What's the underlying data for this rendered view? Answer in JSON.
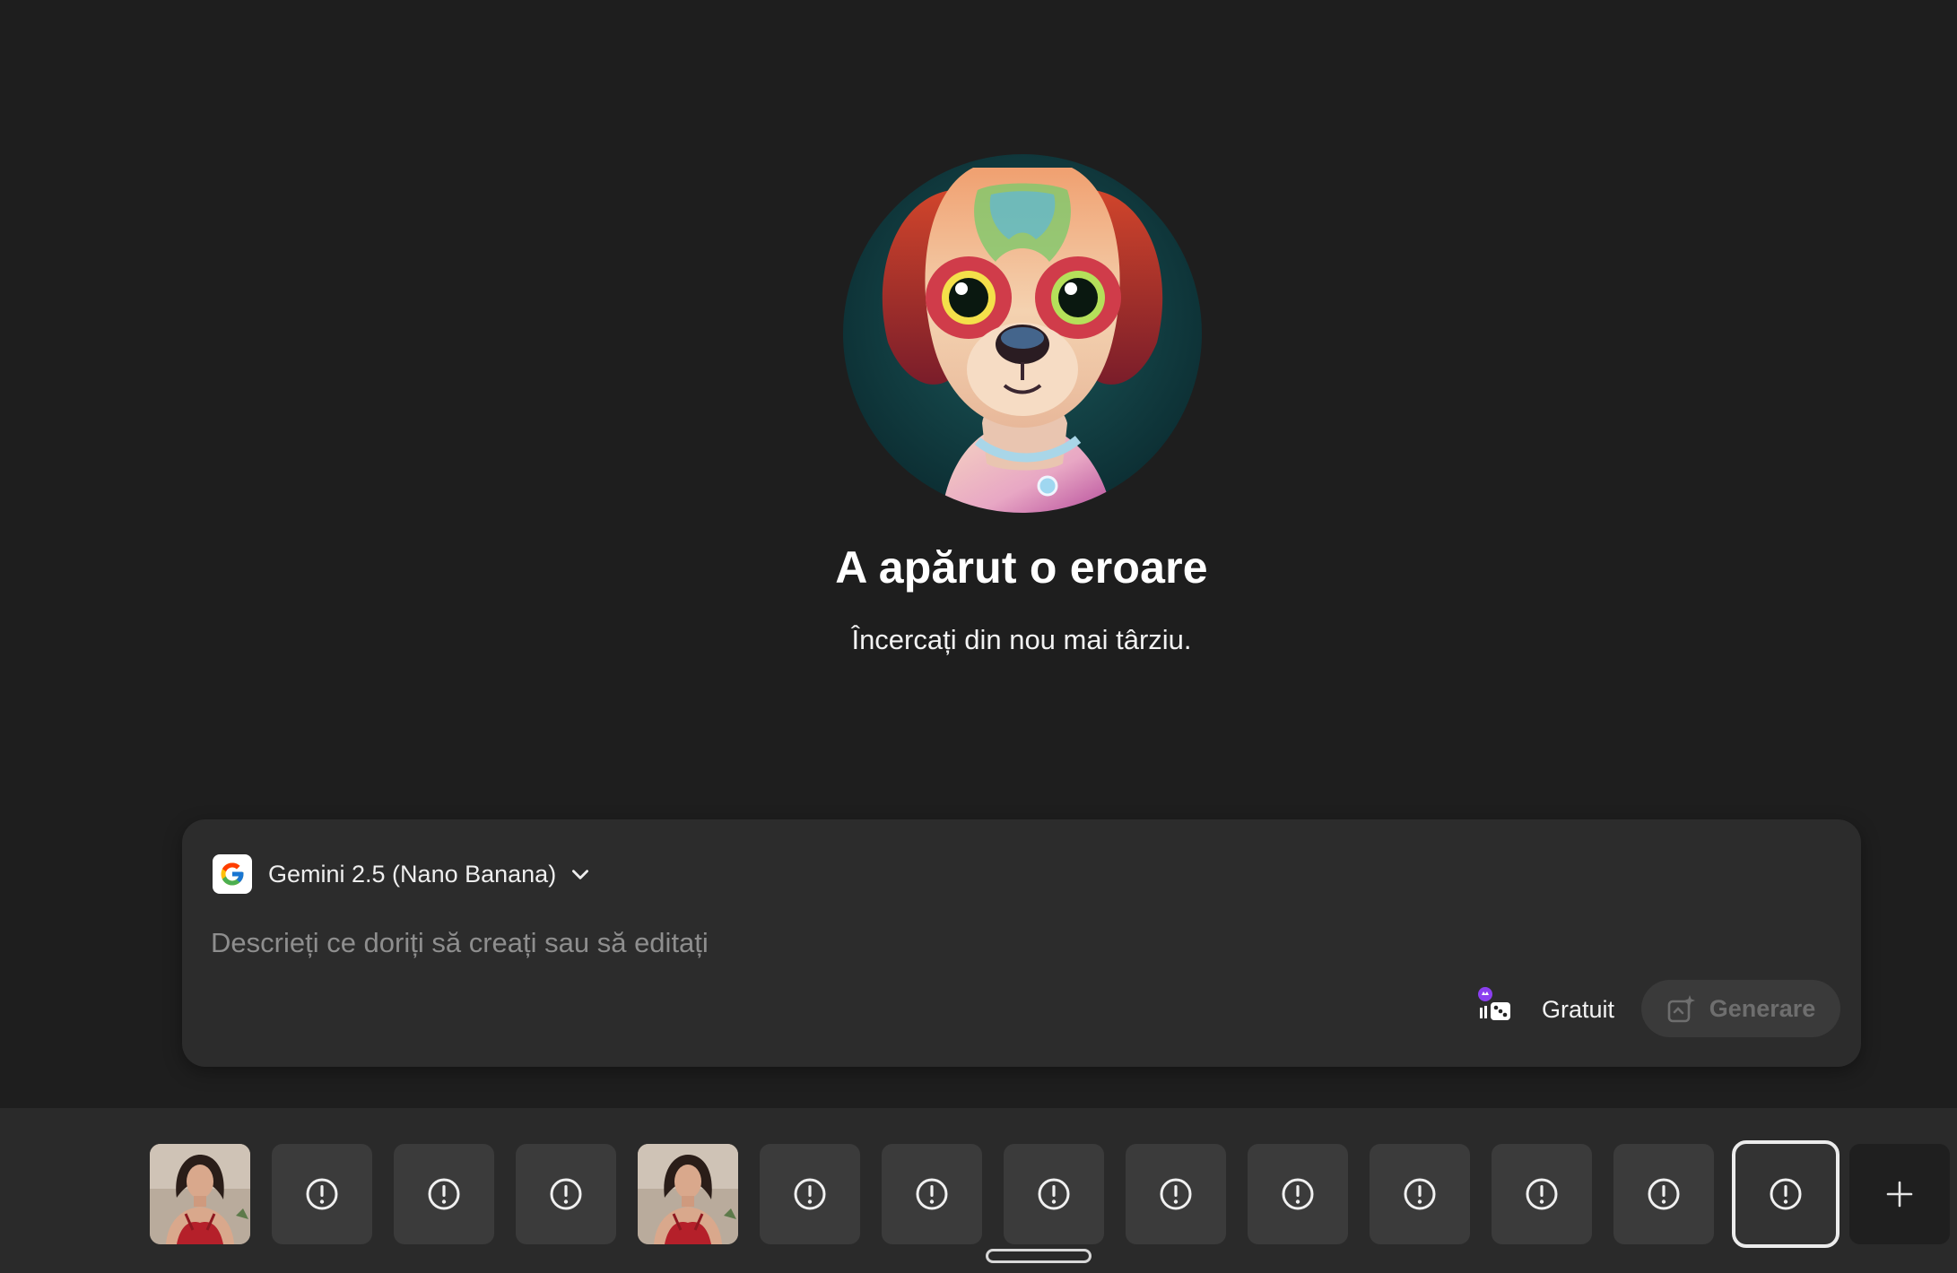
{
  "error": {
    "title": "A apărut o eroare",
    "subtitle": "Încercați din nou mai târziu."
  },
  "prompt": {
    "model_name": "Gemini 2.5 (Nano Banana)",
    "placeholder": "Descrieți ce doriți să creați sau să editați",
    "credit_label": "Gratuit",
    "generate_label": "Generare"
  },
  "filmstrip": {
    "items": [
      {
        "kind": "photo"
      },
      {
        "kind": "error"
      },
      {
        "kind": "error"
      },
      {
        "kind": "error"
      },
      {
        "kind": "photo"
      },
      {
        "kind": "error"
      },
      {
        "kind": "error"
      },
      {
        "kind": "error"
      },
      {
        "kind": "error"
      },
      {
        "kind": "error"
      },
      {
        "kind": "error"
      },
      {
        "kind": "error"
      },
      {
        "kind": "error"
      },
      {
        "kind": "error",
        "selected": true
      }
    ],
    "selected_index": 13
  },
  "icons": {
    "model_logo": "google-g-icon",
    "model_dropdown": "chevron-down-icon",
    "credit": "credit-dice-icon",
    "generate": "generate-sparkle-icon",
    "error_thumb": "alert-circle-icon",
    "add": "plus-icon"
  },
  "colors": {
    "background": "#1e1e1e",
    "panel": "#2c2c2c",
    "filmstrip": "#2a2a2a",
    "thumb": "#3b3b3b",
    "disabled_button": "#3a3a3a"
  }
}
